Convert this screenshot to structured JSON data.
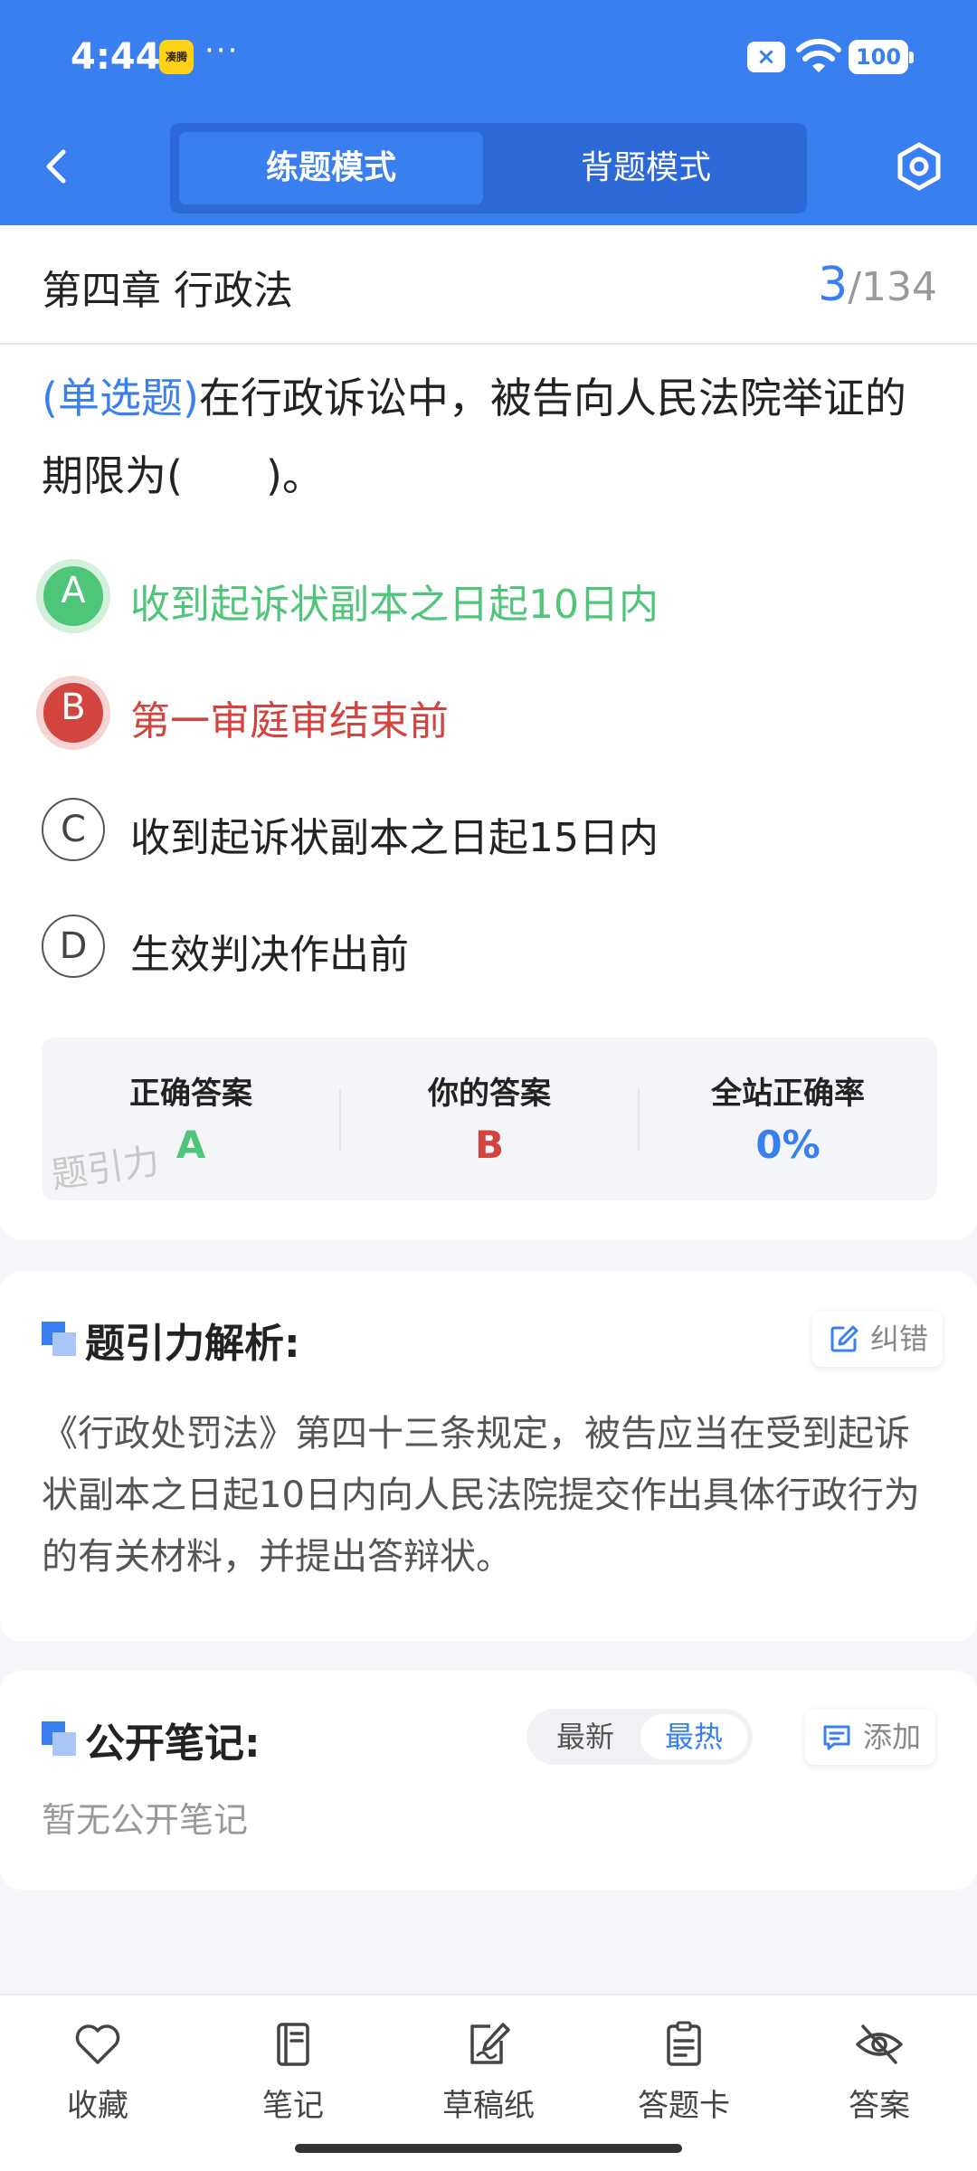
{
  "status_bar": {
    "time": "4:44",
    "app_badge": "凑腾",
    "dots": "···",
    "battery": "100"
  },
  "header": {
    "modes": [
      {
        "label": "练题模式",
        "active": true
      },
      {
        "label": "背题模式",
        "active": false
      }
    ],
    "accent_color": "#3a7ff0"
  },
  "question": {
    "chapter": "第四章 行政法",
    "current": "3",
    "total": "/134",
    "type_tag": "(单选题)",
    "text": "在行政诉讼中，被告向人民法院举证的期限为(　　)。",
    "options": [
      {
        "letter": "A",
        "text": "收到起诉状副本之日起10日内",
        "state": "correct"
      },
      {
        "letter": "B",
        "text": "第一审庭审结束前",
        "state": "wrong"
      },
      {
        "letter": "C",
        "text": "收到起诉状副本之日起15日内",
        "state": "normal"
      },
      {
        "letter": "D",
        "text": "生效判决作出前",
        "state": "normal"
      }
    ]
  },
  "summary": {
    "correct_label": "正确答案",
    "correct_value": "A",
    "yours_label": "你的答案",
    "yours_value": "B",
    "rate_label": "全站正确率",
    "rate_value": "0%",
    "watermark": "题引力",
    "correct_color": "#4fc57a",
    "wrong_color": "#d2453f"
  },
  "analysis": {
    "title": "题引力解析:",
    "report_label": "纠错",
    "text": "《行政处罚法》第四十三条规定，被告应当在受到起诉状副本之日起10日内向人民法院提交作出具体行政行为的有关材料，并提出答辩状。"
  },
  "notes": {
    "title": "公开笔记:",
    "sort_new": "最新",
    "sort_hot": "最热",
    "add_label": "添加",
    "empty": "暂无公开笔记"
  },
  "bottom_bar": [
    {
      "label": "收藏",
      "icon": "heart-icon"
    },
    {
      "label": "笔记",
      "icon": "notebook-icon"
    },
    {
      "label": "草稿纸",
      "icon": "draft-paper-icon"
    },
    {
      "label": "答题卡",
      "icon": "answer-card-icon"
    },
    {
      "label": "答案",
      "icon": "eye-off-icon"
    }
  ]
}
